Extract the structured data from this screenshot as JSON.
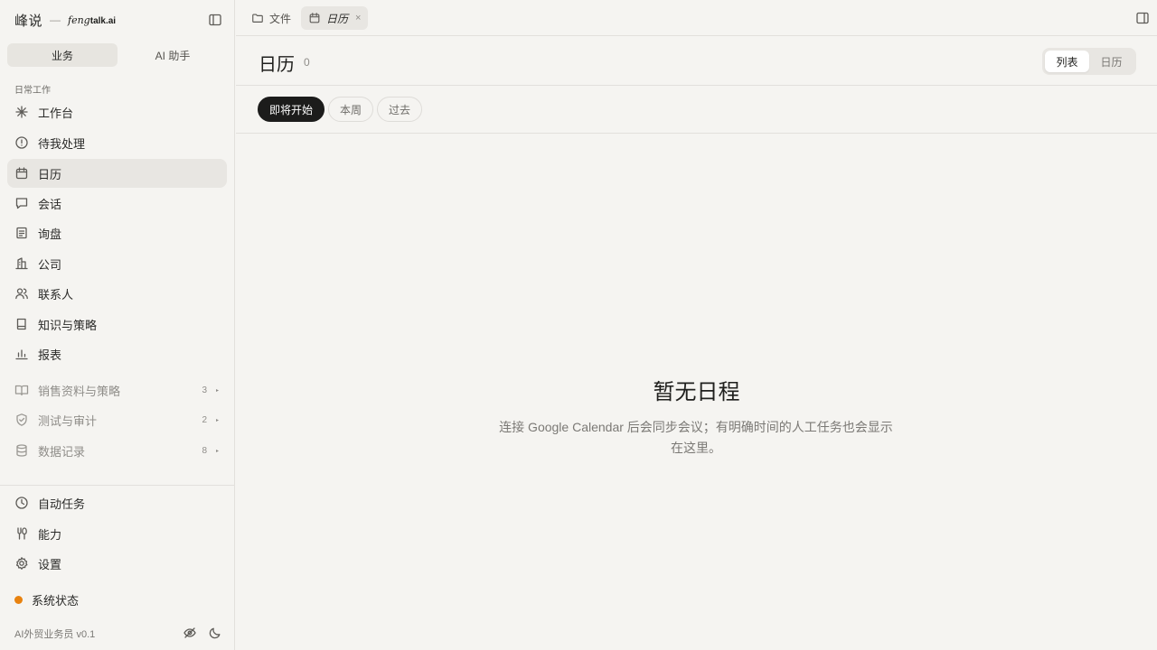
{
  "brand": {
    "name": "峰说",
    "dash": "—",
    "domain_italic": "feng",
    "domain_bold": "talk.ai"
  },
  "mode_tabs": [
    {
      "label": "业务",
      "active": true
    },
    {
      "label": "AI 助手",
      "active": false
    }
  ],
  "section_label": "日常工作",
  "nav": [
    {
      "label": "工作台",
      "icon": "sparkle-icon"
    },
    {
      "label": "待我处理",
      "icon": "alert-circle-icon"
    },
    {
      "label": "日历",
      "icon": "calendar-icon",
      "active": true
    },
    {
      "label": "会话",
      "icon": "chat-bubble-icon"
    },
    {
      "label": "询盘",
      "icon": "inquiry-doc-icon"
    },
    {
      "label": "公司",
      "icon": "building-icon"
    },
    {
      "label": "联系人",
      "icon": "users-icon"
    },
    {
      "label": "知识与策略",
      "icon": "book-icon"
    },
    {
      "label": "报表",
      "icon": "bar-chart-icon"
    }
  ],
  "groups": [
    {
      "label": "销售资料与策略",
      "count": "3",
      "icon": "open-book-icon"
    },
    {
      "label": "测试与审计",
      "count": "2",
      "icon": "shield-check-icon"
    },
    {
      "label": "数据记录",
      "count": "8",
      "icon": "database-icon"
    }
  ],
  "bottom_nav": [
    {
      "label": "自动任务",
      "icon": "clock-icon"
    },
    {
      "label": "能力",
      "icon": "tools-icon"
    },
    {
      "label": "设置",
      "icon": "gear-icon"
    }
  ],
  "status": {
    "label": "系统状态",
    "color": "#e8820f"
  },
  "version": "AI外贸业务员 v0.1",
  "file_tabs": [
    {
      "label": "文件",
      "icon": "folder-icon"
    },
    {
      "label": "日历",
      "icon": "calendar-icon",
      "active": true,
      "close": "×"
    }
  ],
  "header": {
    "title": "日历",
    "count": "0"
  },
  "view_toggle": [
    {
      "label": "列表",
      "active": true
    },
    {
      "label": "日历",
      "active": false
    }
  ],
  "filters": [
    {
      "label": "即将开始",
      "active": true
    },
    {
      "label": "本周"
    },
    {
      "label": "过去"
    }
  ],
  "empty": {
    "title": "暂无日程",
    "description": "连接 Google Calendar 后会同步会议；有明确时间的人工任务也会显示在这里。"
  },
  "colors": {
    "background": "#f5f4f1",
    "active_chip": "#1c1c1b",
    "status_orange": "#e8820f"
  }
}
